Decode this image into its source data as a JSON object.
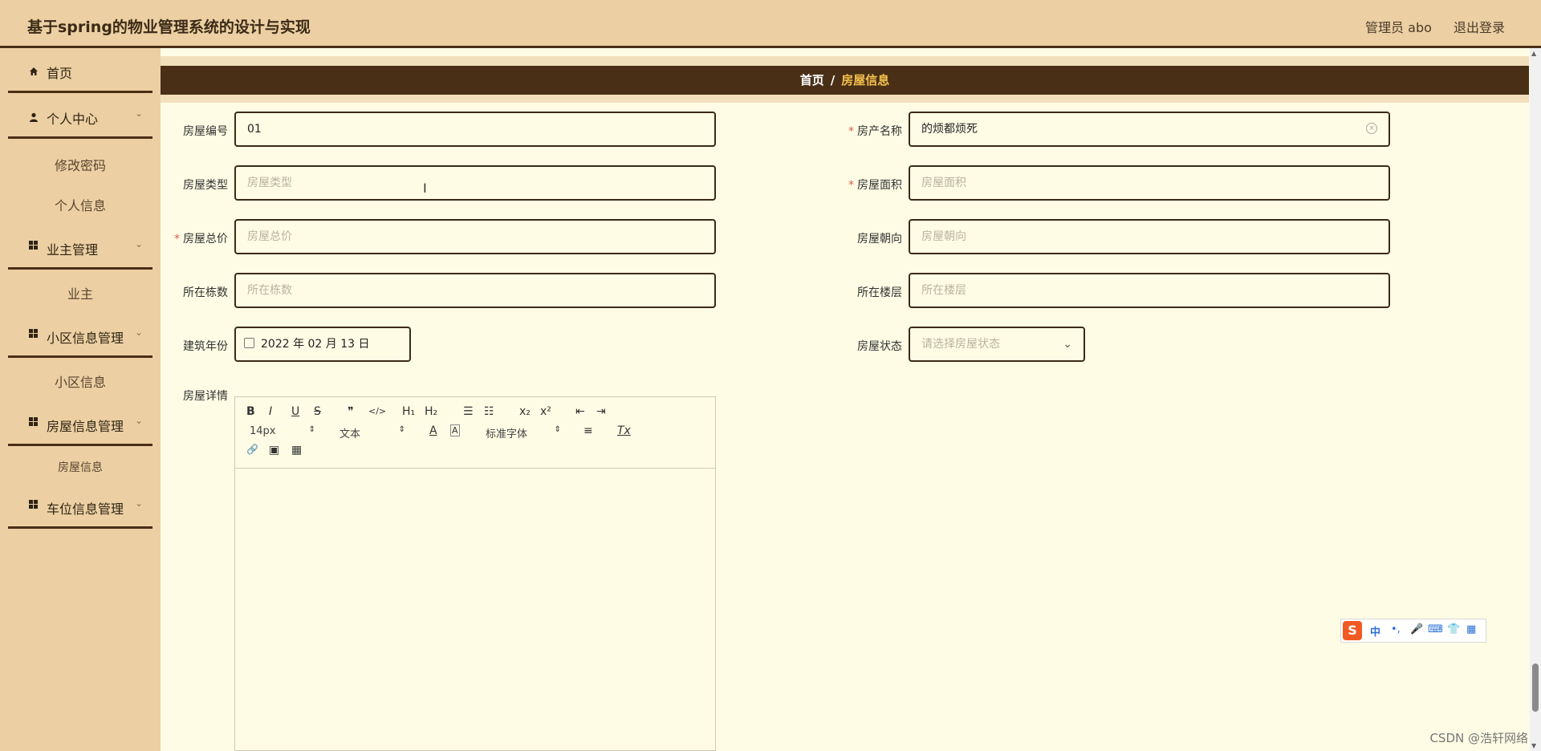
{
  "header": {
    "title": "基于spring的物业管理系统的设计与实现",
    "user_label": "管理员 abo",
    "logout_label": "退出登录"
  },
  "sidebar": {
    "items": [
      {
        "label": "首页"
      },
      {
        "label": "个人中心",
        "children": [
          "修改密码",
          "个人信息"
        ]
      },
      {
        "label": "业主管理",
        "children": [
          "业主"
        ]
      },
      {
        "label": "小区信息管理",
        "children": [
          "小区信息"
        ]
      },
      {
        "label": "房屋信息管理",
        "children": [
          "房屋信息"
        ]
      },
      {
        "label": "车位信息管理"
      }
    ]
  },
  "breadcrumb": {
    "home": "首页",
    "separator": "/",
    "current": "房屋信息"
  },
  "form": {
    "house_no": {
      "label": "房屋编号",
      "value": "01"
    },
    "house_name": {
      "label": "房产名称",
      "value": "的烦都烦死",
      "required": true
    },
    "house_type": {
      "label": "房屋类型",
      "placeholder": "房屋类型"
    },
    "house_area": {
      "label": "房屋面积",
      "placeholder": "房屋面积",
      "required": true
    },
    "total_price": {
      "label": "房屋总价",
      "placeholder": "房屋总价",
      "required": true
    },
    "orientation": {
      "label": "房屋朝向",
      "placeholder": "房屋朝向"
    },
    "building": {
      "label": "所在栋数",
      "placeholder": "所在栋数"
    },
    "floor": {
      "label": "所在楼层",
      "placeholder": "所在楼层"
    },
    "build_year": {
      "label": "建筑年份",
      "value": "2022 年 02 月 13 日"
    },
    "status": {
      "label": "房屋状态",
      "placeholder": "请选择房屋状态"
    },
    "detail": {
      "label": "房屋详情"
    }
  },
  "editor": {
    "font_size": "14px",
    "text_type": "文本",
    "font_family": "标准字体",
    "buttons": {
      "bold": "B",
      "italic": "I",
      "underline": "U",
      "strike": "S",
      "quote": "❞",
      "code": "</>",
      "h1": "H₁",
      "h2": "H₂",
      "ol": "☰",
      "ul": "☷",
      "sub": "x₂",
      "sup": "x²",
      "outdent": "⇤",
      "indent": "⇥",
      "color": "A",
      "bg": "A",
      "align": "≡",
      "clear": "Tx",
      "link": "🔗",
      "image": "▣",
      "video": "▦"
    }
  },
  "ime": {
    "logo": "S",
    "lang": "中"
  },
  "watermark": "CSDN @浩轩网络"
}
